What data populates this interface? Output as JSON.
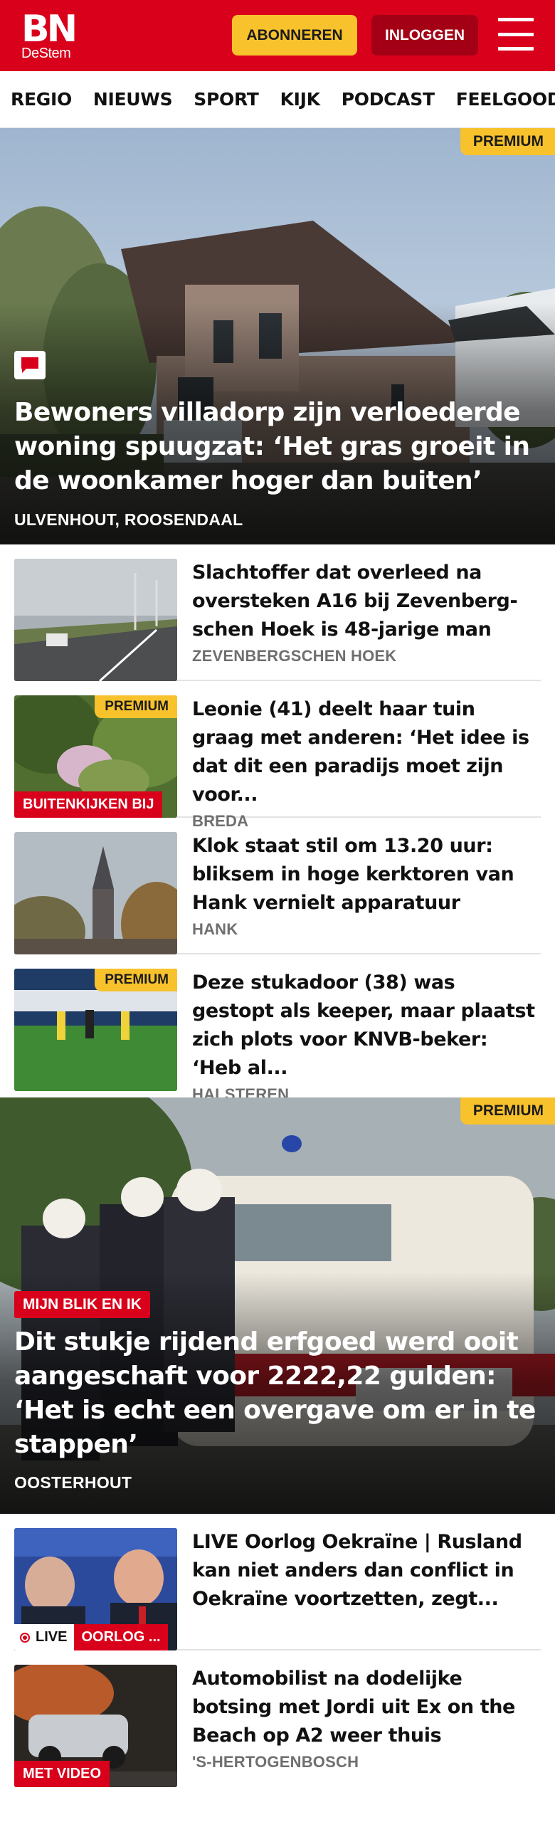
{
  "header": {
    "logo_mark": "BN",
    "logo_sub": "DeStem",
    "subscribe_label": "ABONNEREN",
    "login_label": "INLOGGEN",
    "brand_color": "#d9001b",
    "accent_color": "#f7c22c"
  },
  "nav": {
    "items": [
      "REGIO",
      "NIEUWS",
      "SPORT",
      "KIJK",
      "PODCAST",
      "FEELGOOD"
    ]
  },
  "hero1": {
    "badge": "PREMIUM",
    "icon": "comment-icon",
    "title": "Bewoners villadorp zijn verloederde woning spuugzat: ‘Het gras groeit in de woonkamer hoger dan buiten’",
    "location": "ULVENHOUT, ROOSENDAAL"
  },
  "list1": [
    {
      "title": "Slachtoffer dat overleed na oversteken A16 bij Zevenberg­schen Hoek is 48-jarige man",
      "location": "ZEVENBERGSCHEN HOEK"
    },
    {
      "badge": "PREMIUM",
      "tag": "BUITENKIJKEN BIJ",
      "title": "Leonie (41) deelt haar tuin graag met anderen: ‘Het idee is dat dit een paradijs moet zijn voor...",
      "location": "BREDA"
    },
    {
      "title": "Klok staat stil om 13.20 uur: bliksem in hoge kerktoren van Hank vernielt apparatuur",
      "location": "HANK"
    },
    {
      "badge": "PREMIUM",
      "title": "Deze stukadoor (38) was gestopt als keeper, maar plaatst zich plots voor KNVB-beker: ‘Heb al...",
      "location": "HALSTEREN"
    }
  ],
  "hero2": {
    "badge": "PREMIUM",
    "label": "MIJN BLIK EN IK",
    "title": "Dit stukje rijdend erfgoed werd ooit aangeschaft voor 2222,22 gulden: ‘Het is echt een overgave om er in te stappen’",
    "location": "OOSTERHOUT"
  },
  "list2": [
    {
      "live_label": "LIVE",
      "tag": "OORLOG ...",
      "title": "LIVE Oorlog Oekraïne | Rusland kan niet anders dan conflict in Oekraïne voortzetten, zegt...",
      "location": ""
    },
    {
      "tag": "MET VIDEO",
      "title": "Automobilist na dodelijke botsing met Jordi uit Ex on the Beach op A2 weer thuis",
      "location": "'S-HERTOGENBOSCH"
    }
  ]
}
